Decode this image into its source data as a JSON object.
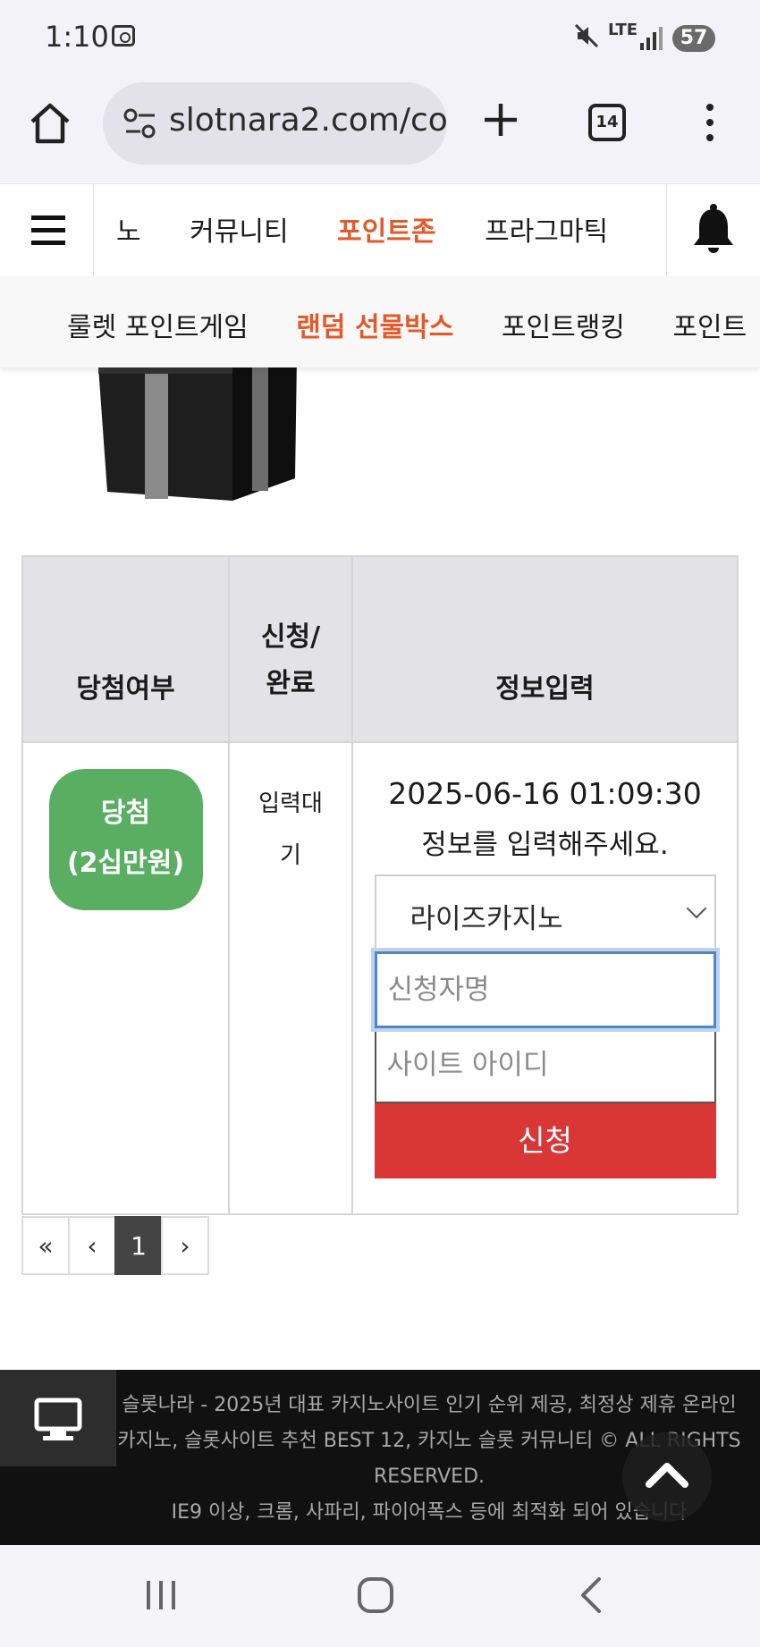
{
  "status_bar": {
    "time": "1:10",
    "network": "LTE",
    "battery": "57"
  },
  "browser": {
    "url": "slotnara2.com/co",
    "tab_count": "14"
  },
  "site_nav": {
    "items": [
      {
        "label": "노",
        "active": false
      },
      {
        "label": "커뮤니티",
        "active": false
      },
      {
        "label": "포인트존",
        "active": true
      },
      {
        "label": "프라그마틱",
        "active": false
      }
    ]
  },
  "sub_nav": {
    "items": [
      {
        "label": "룰렛 포인트게임",
        "active": false
      },
      {
        "label": "랜덤 선물박스",
        "active": true
      },
      {
        "label": "포인트랭킹",
        "active": false
      },
      {
        "label": "포인트",
        "active": false
      }
    ]
  },
  "table": {
    "headers": {
      "result": "당첨여부",
      "status_line1": "신청/",
      "status_line2": "완료",
      "info": "정보입력"
    },
    "row": {
      "badge_line1": "당첨",
      "badge_line2": "(2십만원)",
      "status_line1": "입력대",
      "status_line2": "기",
      "date": "2025-06-16 01:09:30",
      "message": "정보를 입력해주세요.",
      "site_selected": "라이즈카지노",
      "name_placeholder": "신청자명",
      "id_placeholder": "사이트 아이디",
      "apply_label": "신청"
    }
  },
  "pagination": {
    "first": "«",
    "prev": "‹",
    "current": "1",
    "next": "›"
  },
  "footer": {
    "line1": "슬롯나라 - 2025년 대표 카지노사이트 인기 순위 제공, 최정상 제휴 온라인 카지노, 슬롯사이트 추천 BEST 12, 카지노 슬롯 커뮤니티 © ALL RIGHTS RESERVED.",
    "line2": "IE9 이상, 크롬, 사파리, 파이어폭스 등에 최적화 되어 있습니다"
  },
  "colors": {
    "accent": "#e35a2a",
    "win_badge": "#5aae62",
    "apply_button": "#d93636",
    "header_bg": "#e3e2e6"
  },
  "icons": [
    "home-icon",
    "tune-icon",
    "plus-icon",
    "tabs-icon",
    "more-vert-icon",
    "hamburger-icon",
    "bell-icon",
    "chevron-down-icon",
    "desktop-icon",
    "arrow-up-icon",
    "recent-apps-icon",
    "android-home-icon",
    "back-icon"
  ]
}
